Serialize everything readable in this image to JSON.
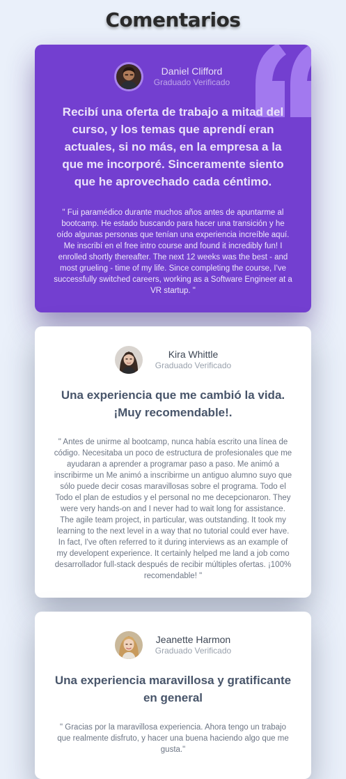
{
  "page": {
    "title": "Comentarios"
  },
  "testimonials": [
    {
      "name": "Daniel Clifford",
      "role": "Graduado Verificado",
      "headline": "Recibí una oferta de trabajo a mitad del curso, y los temas que aprendí eran actuales, si no más, en la empresa a la que me incorporé. Sinceramente siento que he aprovechado cada céntimo.",
      "body": "\" Fui paramédico durante muchos años antes de apuntarme al bootcamp. He estado buscando para hacer una transición y he oído algunas personas que tenían una experiencia increíble aquí. Me inscribí en el free intro course and found it incredibly fun! I enrolled shortly thereafter. The next 12 weeks was the best - and most grueling - time of my life. Since completing the course, I've successfully switched careers, working as a Software Engineer at a VR startup. \""
    },
    {
      "name": "Kira Whittle",
      "role": "Graduado Verificado",
      "headline": "Una experiencia que me cambió la vida. ¡Muy recomendable!.",
      "body": "\" Antes de unirme al bootcamp, nunca había escrito una línea de código. Necesitaba un poco de estructura de profesionales que me ayudaran a aprender a programar paso a paso. Me animó a inscribirme un Me animó a inscribirme un antiguo alumno suyo que sólo puede decir cosas maravillosas sobre el programa. Todo el Todo el plan de estudios y el personal no me decepcionaron. They were very hands-on and I never had to wait long for assistance. The agile team project, in particular, was outstanding. It took my learning to the next level in a way that no tutorial could ever have. In fact, I've often referred to it during interviews as an example of my developent experience. It certainly helped me land a job como desarrollador full-stack después de recibir múltiples ofertas. ¡100% recomendable! \""
    },
    {
      "name": "Jeanette Harmon",
      "role": "Graduado Verificado",
      "headline": "Una experiencia maravillosa y gratificante en general",
      "body": "\" Gracias por la maravillosa experiencia. Ahora tengo un trabajo que realmente disfruto, y hacer una buena haciendo algo que me gusta.\""
    }
  ],
  "colors": {
    "background": "#eaf0fa",
    "primary_card": "#733fd0",
    "light_card": "#ffffff",
    "text_dark": "#48556a",
    "accent_quote": "#a77ff2"
  },
  "icons": {
    "quote": "quotation-mark-icon"
  }
}
